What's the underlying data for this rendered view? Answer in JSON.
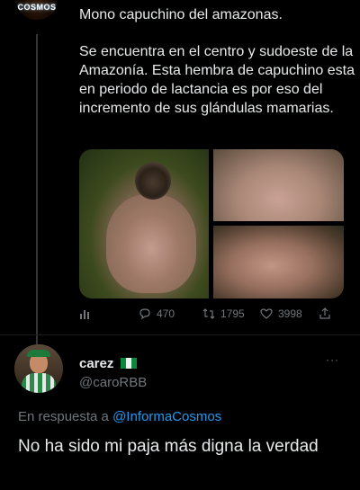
{
  "tweet": {
    "account_logo_text": "COSMOS",
    "title": "Mono capuchino del amazonas.",
    "body": "Se encuentra en el centro y sudoeste de la Amazonía. Esta hembra de capuchino esta en periodo de lactancia es por eso del incremento de sus glándulas mamarias.",
    "actions": {
      "replies": "470",
      "retweets": "1795",
      "likes": "3998"
    }
  },
  "reply": {
    "display_name": "carez",
    "handle": "@caroRBB",
    "replying_to_prefix": "En respuesta a",
    "replying_to_handle": "@InformaCosmos",
    "text": "No ha sido mi paja más digna la verdad"
  },
  "colors": {
    "background": "#000000",
    "text": "#e7e9ea",
    "muted": "#71767b",
    "link": "#1d9bf0"
  },
  "icons": [
    "stats-icon",
    "reply-icon",
    "retweet-icon",
    "like-icon",
    "share-icon",
    "more-icon",
    "flag-icon"
  ]
}
